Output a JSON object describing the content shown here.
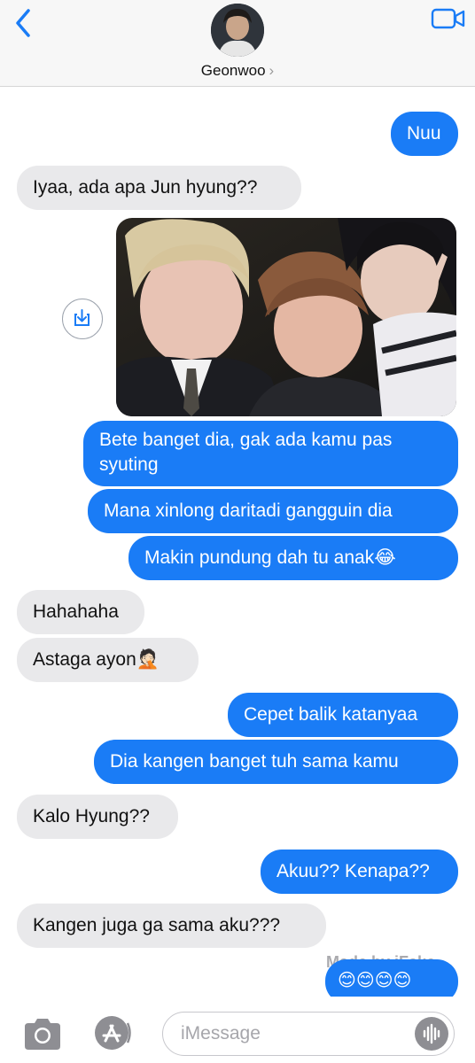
{
  "header": {
    "contact_name": "Geonwoo",
    "chevron": "›"
  },
  "messages": [
    {
      "dir": "out",
      "text": "Nuu"
    },
    {
      "dir": "in",
      "text": "Iyaa, ada apa Jun hyung??"
    },
    {
      "dir": "out",
      "type": "image",
      "alt": "photo attachment"
    },
    {
      "dir": "out",
      "text": "Bete banget dia, gak ada kamu pas syuting"
    },
    {
      "dir": "out",
      "text": "Mana xinlong daritadi gangguin dia"
    },
    {
      "dir": "out",
      "text": "Makin pundung dah tu anak😂"
    },
    {
      "dir": "in",
      "text": "Hahahaha"
    },
    {
      "dir": "in",
      "text": "Astaga ayon🤦🏻"
    },
    {
      "dir": "out",
      "text": "Cepet balik katanyaa"
    },
    {
      "dir": "out",
      "text": "Dia kangen banget tuh sama kamu"
    },
    {
      "dir": "in",
      "text": "Kalo Hyung??"
    },
    {
      "dir": "out",
      "text": "Akuu?? Kenapa??"
    },
    {
      "dir": "in",
      "text": "Kangen juga ga sama aku???"
    },
    {
      "dir": "out",
      "text": "😊😊😊😊"
    }
  ],
  "watermark": "Made by iFake",
  "composer": {
    "placeholder": "iMessage"
  },
  "icons": [
    "back-chevron-icon",
    "video-camera-icon",
    "save-download-icon",
    "camera-icon",
    "app-store-icon",
    "audio-waveform-icon"
  ],
  "colors": {
    "outgoing": "#1a7cf6",
    "incoming": "#e9e9eb",
    "accent": "#1a7cf6"
  }
}
